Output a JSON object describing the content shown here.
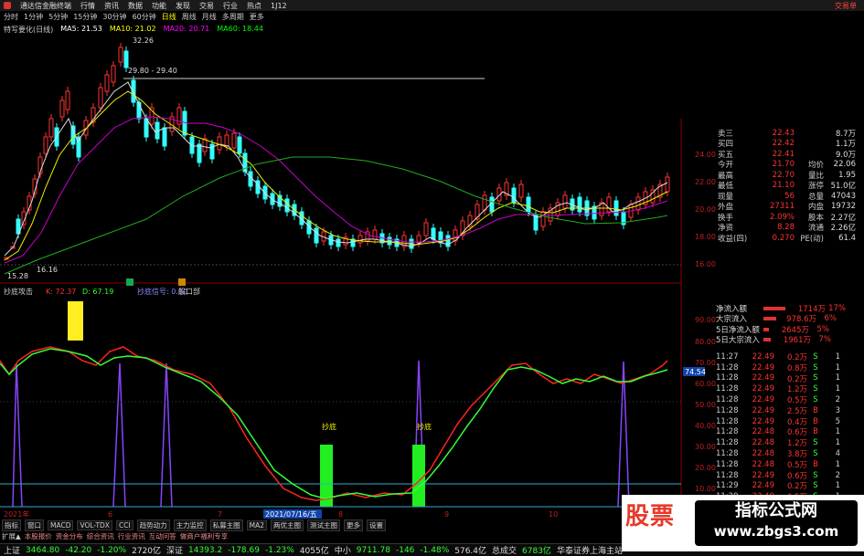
{
  "titlebar": {
    "app_title": "通达信金融终端",
    "menus": [
      "行情",
      "资讯",
      "数据",
      "功能",
      "发现",
      "交易",
      "行业",
      "热点",
      "1J12"
    ],
    "trade": "交易单"
  },
  "toolbar": {
    "items": [
      "分时",
      "1分钟",
      "5分钟",
      "15分钟",
      "30分钟",
      "60分钟",
      "日线",
      "周线",
      "月线",
      "多周期",
      "更多"
    ],
    "active": "日线"
  },
  "ma": {
    "name": "特写要化(日线)",
    "ma5": "MA5: 21.53",
    "ma10": "MA10: 21.02",
    "ma20": "MA20: 20.71",
    "ma60": "MA60: 18.44"
  },
  "price_labels": {
    "high": "32.26",
    "range": "29.80 - 29.40",
    "low": "16.16",
    "low2": "15.28"
  },
  "indicator": {
    "name": "抄底攻击",
    "k": "K: 72.37",
    "d": "D: 67.19",
    "sig1": "抄底信号: 0.00",
    "sig2": "股口部"
  },
  "signal_labels": [
    "抄底",
    "抄底"
  ],
  "indicator_axis": [
    "90.00",
    "80.00",
    "70.00",
    "60.00",
    "50.00",
    "40.00",
    "30.00",
    "20.00",
    "10.00"
  ],
  "current_k": "74.54",
  "date_axis": {
    "left": "2021年",
    "m1": "6",
    "m2": "7",
    "highlight": "2021/07/16/五",
    "m3": "8",
    "m4": "9",
    "m5": "10"
  },
  "price_axis": [
    "24.00",
    "22.00",
    "20.00",
    "18.00",
    "16.00"
  ],
  "quote": [
    {
      "l": "卖三",
      "v": "22.43",
      "l2": "",
      "v2": "8.7万"
    },
    {
      "l": "买四",
      "v": "22.42",
      "l2": "",
      "v2": "1.1万"
    },
    {
      "l": "买五",
      "v": "22.41",
      "l2": "",
      "v2": "9.0万"
    },
    {
      "l": "今开",
      "v": "21.70",
      "l2": "均价",
      "v2": "22.06"
    },
    {
      "l": "最高",
      "v": "22.70",
      "l2": "量比",
      "v2": "1.95"
    },
    {
      "l": "最低",
      "v": "21.10",
      "l2": "涨停",
      "v2": "51.0亿"
    },
    {
      "l": "现量",
      "v": "56",
      "l2": "总量",
      "v2": "47043"
    },
    {
      "l": "外盘",
      "v": "27311",
      "l2": "内盘",
      "v2": "19732"
    },
    {
      "l": "换手",
      "v": "2.09%",
      "l2": "股本",
      "v2": "2.27亿"
    },
    {
      "l": "净资",
      "v": "8.28",
      "l2": "流通",
      "v2": "2.26亿"
    },
    {
      "l": "收益(四)",
      "v": "0.270",
      "l2": "PE(动)",
      "v2": "61.4"
    }
  ],
  "flow": [
    {
      "lab": "净流入额",
      "amt": "1714万",
      "pct": "17%"
    },
    {
      "lab": "大宗流入",
      "amt": "978.6万",
      "pct": "6%"
    },
    {
      "lab": "5日净流入额",
      "amt": "2645万",
      "pct": "5%"
    },
    {
      "lab": "5日大宗流入",
      "amt": "1961万",
      "pct": "7%"
    }
  ],
  "ticks": [
    {
      "t": "11:27",
      "p": "22.49",
      "q": "0.2万",
      "bs": "S",
      "n": "1"
    },
    {
      "t": "11:28",
      "p": "22.49",
      "q": "0.8万",
      "bs": "S",
      "n": "1"
    },
    {
      "t": "11:28",
      "p": "22.49",
      "q": "0.2万",
      "bs": "S",
      "n": "1"
    },
    {
      "t": "11:28",
      "p": "22.49",
      "q": "1.2万",
      "bs": "S",
      "n": "1"
    },
    {
      "t": "11:28",
      "p": "22.49",
      "q": "0.5万",
      "bs": "S",
      "n": "2"
    },
    {
      "t": "11:28",
      "p": "22.49",
      "q": "2.5万",
      "bs": "B",
      "n": "3"
    },
    {
      "t": "11:28",
      "p": "22.49",
      "q": "0.4万",
      "bs": "B",
      "n": "5"
    },
    {
      "t": "11:28",
      "p": "22.48",
      "q": "0.6万",
      "bs": "B",
      "n": "1"
    },
    {
      "t": "11:28",
      "p": "22.48",
      "q": "1.2万",
      "bs": "S",
      "n": "1"
    },
    {
      "t": "11:28",
      "p": "22.48",
      "q": "3.8万",
      "bs": "S",
      "n": "4"
    },
    {
      "t": "11:28",
      "p": "22.48",
      "q": "0.5万",
      "bs": "B",
      "n": "1"
    },
    {
      "t": "11:28",
      "p": "22.49",
      "q": "0.6万",
      "bs": "S",
      "n": "2"
    },
    {
      "t": "11:29",
      "p": "22.49",
      "q": "0.2万",
      "bs": "S",
      "n": "1"
    },
    {
      "t": "11:29",
      "p": "22.49",
      "q": "0.5万",
      "bs": "S",
      "n": "1"
    },
    {
      "t": "11:29",
      "p": "22.49",
      "q": "0.5万",
      "bs": "S",
      "n": "1"
    },
    {
      "t": "11:29",
      "p": "22.49",
      "q": "6.7万",
      "bs": "B",
      "n": "3"
    }
  ],
  "bottom_tabs": [
    "指标",
    "窗口",
    "MACD",
    "VOL-TDX",
    "CCI",
    "趋势动力",
    "主力监控",
    "私募主图",
    "MA2",
    "两优主图",
    "测试主图",
    "更多",
    "设置"
  ],
  "bottom_tabs2": [
    "扩展▲",
    "本股报价",
    "资金分布",
    "综合资讯",
    "行业资讯",
    "互动问答",
    "做商户福利专享"
  ],
  "status": [
    {
      "label": "上证",
      "value": "3464.80",
      "chg": "-42.20",
      "pct": "-1.20%",
      "vol": "2720亿"
    },
    {
      "label": "深证",
      "value": "14393.2",
      "chg": "-178.69",
      "pct": "-1.23%",
      "vol": "4055亿"
    },
    {
      "label": "中小",
      "value": "9711.78",
      "chg": "-146",
      "pct": "-1.48%",
      "vol": "576.4亿"
    },
    {
      "label": "总成交",
      "value": "6783亿",
      "chg": "",
      "pct": "",
      "vol": ""
    }
  ],
  "status_tail": "华泰证券上海主站",
  "watermark": {
    "text": "股票",
    "badge1": "指标公式网",
    "badge2": "www.zbgs3.com"
  },
  "colors": {
    "up": "#ff3333",
    "down": "#33ffff",
    "k_line": "#ff2222",
    "d_line": "#33ff33",
    "signal": "#8844ff",
    "ma20": "#cc00cc",
    "ma60": "#22aa22"
  }
}
